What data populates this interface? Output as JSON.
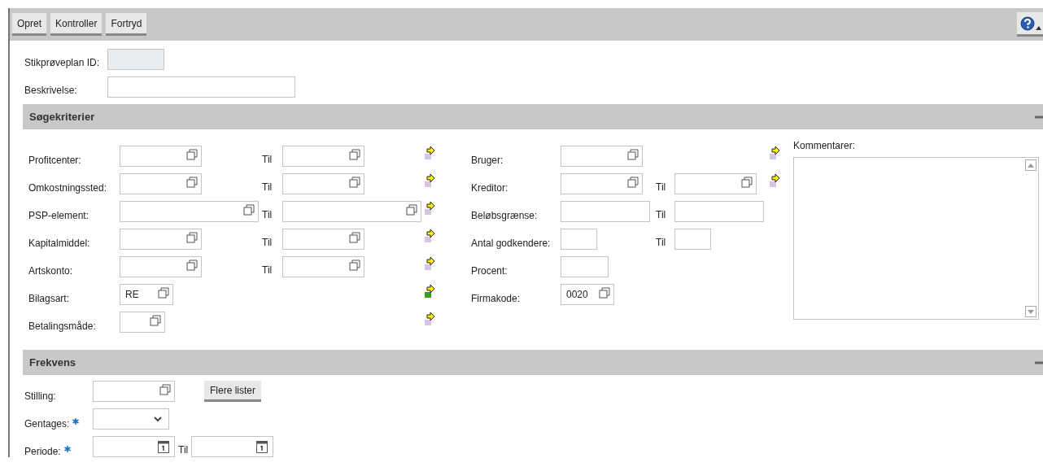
{
  "toolbar": {
    "buttons": [
      "Opret",
      "Kontroller",
      "Fortryd"
    ]
  },
  "header_fields": [
    {
      "label": "Stikprøveplan ID:",
      "kind": "shorttext",
      "disabled": true
    },
    {
      "label": "Beskrivelse:",
      "kind": "longtext",
      "disabled": false
    }
  ],
  "search_criteria": {
    "title": "Søgekriterier",
    "expanded": true,
    "left_rows": [
      {
        "label": "Profitcenter:",
        "from": {
          "kind": "lookup"
        },
        "to_label": "Til",
        "to": {
          "kind": "lookup"
        },
        "selection_set": false
      },
      {
        "label": "Omkostningssted:",
        "from": {
          "kind": "lookup"
        },
        "to_label": "Til",
        "to": {
          "kind": "lookup"
        },
        "selection_set": false
      },
      {
        "label": "PSP-element:",
        "from": {
          "kind": "widelookup"
        },
        "to_label": "Til",
        "to": {
          "kind": "widelookup"
        },
        "selection_set": false
      },
      {
        "label": "Kapitalmiddel:",
        "from": {
          "kind": "lookup"
        },
        "to_label": "Til",
        "to": {
          "kind": "lookup"
        },
        "selection_set": false
      },
      {
        "label": "Artskonto:",
        "from": {
          "kind": "lookup"
        },
        "to_label": "Til",
        "to": {
          "kind": "lookup"
        },
        "selection_set": false
      },
      {
        "label": "Bilagsart:",
        "from": {
          "kind": "shortlookup",
          "value": "RE"
        },
        "selection_set": true
      },
      {
        "label": "Betalingsmåde:",
        "from": {
          "kind": "tinylookup"
        },
        "selection_set": false
      }
    ],
    "right_rows": [
      {
        "label": "Bruger:",
        "from": {
          "kind": "lookup"
        },
        "selection_set": false
      },
      {
        "label": "Kreditor:",
        "from": {
          "kind": "lookup"
        },
        "to_label": "Til",
        "to": {
          "kind": "lookup"
        },
        "selection_set": false
      },
      {
        "label": "Beløbsgrænse:",
        "from": {
          "kind": "text"
        },
        "to_label": "Til",
        "to": {
          "kind": "text"
        }
      },
      {
        "label": "Antal godkendere:",
        "from": {
          "kind": "shorttext"
        },
        "to_label": "Til",
        "to": {
          "kind": "shorttext"
        }
      },
      {
        "label": "Procent:",
        "from": {
          "kind": "midtext"
        }
      },
      {
        "label": "Firmakode:",
        "from": {
          "kind": "shortlookup",
          "value": "0020"
        }
      }
    ],
    "comments": {
      "label": "Kommentarer:"
    }
  },
  "frequency": {
    "title": "Frekvens",
    "expanded": true,
    "rows": [
      {
        "label": "Stilling:",
        "required": false,
        "field": {
          "kind": "lookup"
        },
        "button": "Flere lister"
      },
      {
        "label": "Gentages:",
        "required": true,
        "field": {
          "kind": "select"
        }
      },
      {
        "label": "Periode:",
        "required": true,
        "field": {
          "kind": "date"
        },
        "to_label": "Til",
        "to": {
          "kind": "date"
        }
      }
    ]
  }
}
